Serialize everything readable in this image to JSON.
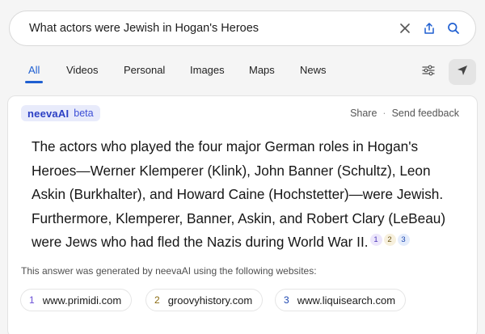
{
  "search": {
    "query": "What actors were Jewish in Hogan's Heroes",
    "icons": [
      "close-icon",
      "share-icon",
      "search-icon"
    ]
  },
  "tabs": [
    {
      "label": "All",
      "active": true
    },
    {
      "label": "Videos",
      "active": false
    },
    {
      "label": "Personal",
      "active": false
    },
    {
      "label": "Images",
      "active": false
    },
    {
      "label": "Maps",
      "active": false
    },
    {
      "label": "News",
      "active": false
    }
  ],
  "toolbar": {
    "icons": [
      "filter-sliders-icon",
      "location-arrow-icon"
    ]
  },
  "answer_card": {
    "brand": "neevaAI",
    "badge": "beta",
    "actions": {
      "share": "Share",
      "separator": "·",
      "feedback": "Send feedback"
    },
    "answer_text": "The actors who played the four major German roles in Hogan's Heroes—Werner Klemperer (Klink), John Banner (Schultz), Leon Askin (Burkhalter), and Howard Caine (Hochstetter)—were Jewish. Furthermore, Klemperer, Banner, Askin, and Robert Clary (LeBeau) were Jews who had fled the Nazis during World War II.",
    "citations": [
      "1",
      "2",
      "3"
    ],
    "generated_note": "This answer was generated by neevaAI using the following websites:",
    "sources": [
      {
        "num": "1",
        "url": "www.primidi.com"
      },
      {
        "num": "2",
        "url": "groovyhistory.com"
      },
      {
        "num": "3",
        "url": "www.liquisearch.com"
      }
    ]
  },
  "colors": {
    "accent": "#1f5fd1",
    "brand": "#2b3fc4",
    "background": "#f5f5f5",
    "card": "#ffffff"
  }
}
